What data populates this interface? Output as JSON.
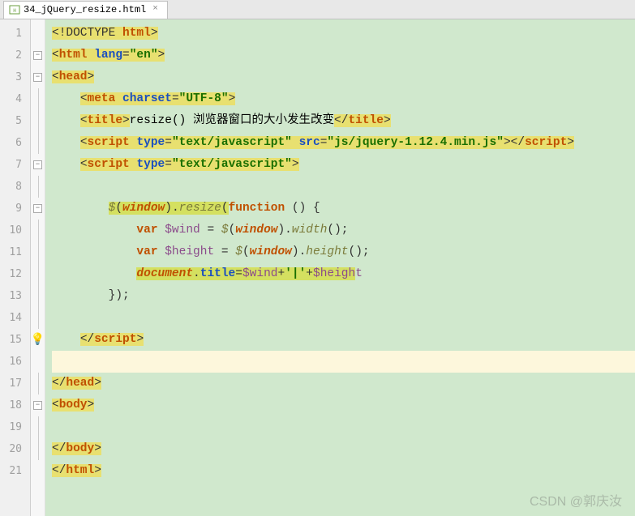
{
  "tab": {
    "filename": "34_jQuery_resize.html",
    "close": "×"
  },
  "gutter": {
    "lines": [
      "1",
      "2",
      "3",
      "4",
      "5",
      "6",
      "7",
      "8",
      "9",
      "10",
      "11",
      "12",
      "13",
      "14",
      "15",
      "16",
      "17",
      "18",
      "19",
      "20",
      "21"
    ],
    "fold_minus": "−"
  },
  "code": {
    "l1": {
      "a": "<!DOCTYPE ",
      "b": "html",
      "c": ">"
    },
    "l2": {
      "a": "<",
      "b": "html ",
      "c": "lang",
      "d": "=",
      "e": "\"en\"",
      "f": ">"
    },
    "l3": {
      "a": "<",
      "b": "head",
      "c": ">"
    },
    "l4": {
      "a": "<",
      "b": "meta ",
      "c": "charset",
      "d": "=",
      "e": "\"UTF-8\"",
      "f": ">"
    },
    "l5": {
      "a": "<",
      "b": "title",
      "c": ">",
      "d": "resize() 浏览器窗口的大小发生改变",
      "e": "</",
      "f": "title",
      "g": ">"
    },
    "l6": {
      "a": "<",
      "b": "script ",
      "c": "type",
      "d": "=",
      "e": "\"text/javascript\"",
      "f": " ",
      "g": "src",
      "h": "=",
      "i": "\"js/jquery-1.12.4.min.js\"",
      "j": "></",
      "k": "script",
      "l": ">"
    },
    "l7": {
      "a": "<",
      "b": "script ",
      "c": "type",
      "d": "=",
      "e": "\"text/javascript\"",
      "f": ">"
    },
    "l9": {
      "a": "$",
      "b": "(",
      "c": "window",
      "d": ").",
      "e": "resize",
      "f": "(",
      "g": "function ",
      "h": "() {"
    },
    "l10": {
      "a": "var ",
      "b": "$wind",
      "c": " = ",
      "d": "$",
      "e": "(",
      "f": "window",
      "g": ").",
      "h": "width",
      "i": "();"
    },
    "l11": {
      "a": "var ",
      "b": "$height",
      "c": " = ",
      "d": "$",
      "e": "(",
      "f": "window",
      "g": ").",
      "h": "height",
      "i": "();"
    },
    "l12": {
      "a": "document",
      "b": ".",
      "c": "title",
      "d": "=",
      "e": "$wind",
      "f": "+",
      "g": "'|'",
      "h": "+",
      "i": "$heigh",
      "j": "t"
    },
    "l13": {
      "a": "});"
    },
    "l15": {
      "a": "</",
      "b": "script",
      "c": ">"
    },
    "l17": {
      "a": "</",
      "b": "head",
      "c": ">"
    },
    "l18": {
      "a": "<",
      "b": "body",
      "c": ">"
    },
    "l20": {
      "a": "</",
      "b": "body",
      "c": ">"
    },
    "l21": {
      "a": "</",
      "b": "html",
      "c": ">"
    }
  },
  "watermark": "CSDN @郭庆汝"
}
